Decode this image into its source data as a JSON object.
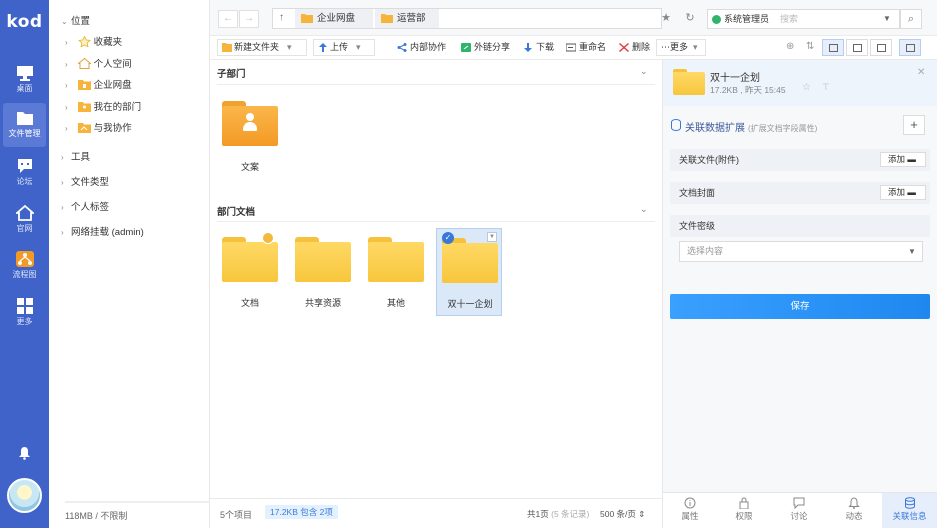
{
  "app": {
    "logo": "kod"
  },
  "rail": [
    {
      "name": "desktop",
      "label": "桌面"
    },
    {
      "name": "files",
      "label": "文件管理"
    },
    {
      "name": "forum",
      "label": "论坛"
    },
    {
      "name": "website",
      "label": "官网"
    },
    {
      "name": "flowchart",
      "label": "流程图"
    },
    {
      "name": "more",
      "label": "更多"
    }
  ],
  "tree": {
    "root": "位置",
    "items": [
      "收藏夹",
      "个人空间",
      "企业网盘",
      "我在的部门",
      "与我协作"
    ],
    "groups": [
      "工具",
      "文件类型",
      "个人标签",
      "网络挂载 (admin)"
    ],
    "storage": "118MB / 不限制"
  },
  "topbar": {
    "breadcrumbs": [
      "企业网盘",
      "运营部"
    ],
    "admin": "系统管理员",
    "search_placeholder": "搜索"
  },
  "actions": {
    "new_folder": "新建文件夹",
    "upload": "上传",
    "collab": "内部协作",
    "share": "外链分享",
    "download": "下载",
    "rename": "重命名",
    "delete": "删除",
    "more": "更多"
  },
  "main": {
    "section_sub": "子部门",
    "section_docs": "部门文档",
    "sub_items": [
      {
        "label": "文案"
      }
    ],
    "doc_items": [
      {
        "label": "文档"
      },
      {
        "label": "共享资源"
      },
      {
        "label": "其他"
      },
      {
        "label": "双十一企划"
      }
    ]
  },
  "status": {
    "count": "5个项目",
    "selected": "17.2KB 包含 2项",
    "pages": "共1页",
    "records": "(5 条记录)",
    "per_page": "500 条/页"
  },
  "panel": {
    "title": "双十一企划",
    "meta": "17.2KB , 昨天 15:45",
    "section_title": "关联数据扩展",
    "section_sub": "(扩展文档字段属性)",
    "field_attach": "关联文件(附件)",
    "field_cover": "文档封面",
    "add_label": "添加",
    "field_secret": "文件密级",
    "select_placeholder": "选择内容",
    "save": "保存",
    "tabs": [
      "属性",
      "权限",
      "讨论",
      "动态",
      "关联信息"
    ]
  },
  "colors": {
    "rail": "#3f63c8",
    "accent": "#1e88f0",
    "folder": "#f7c63d"
  }
}
